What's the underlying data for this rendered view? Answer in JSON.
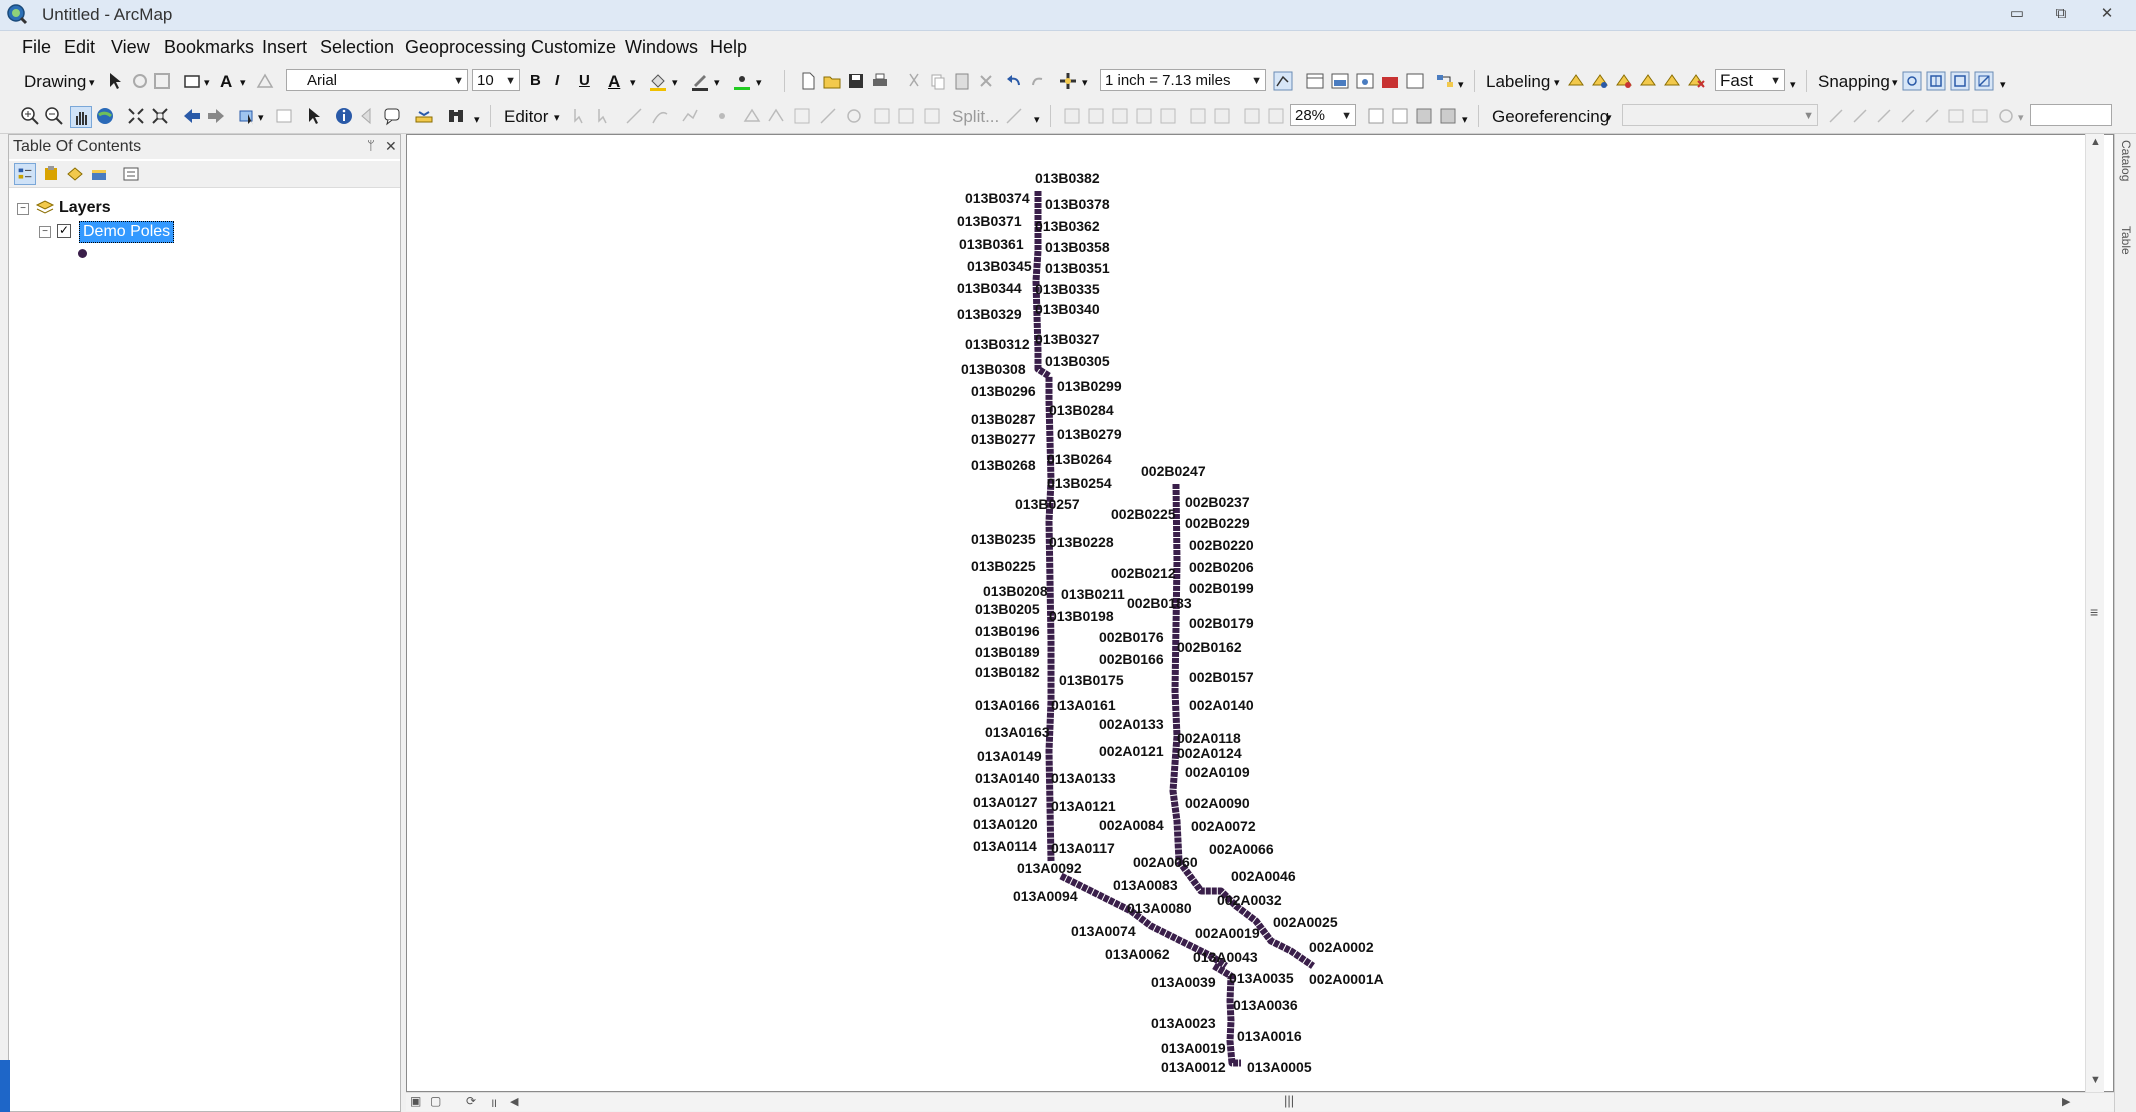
{
  "window": {
    "title": "Untitled - ArcMap",
    "minimize": "▭",
    "maximize": "⧉",
    "close": "✕"
  },
  "menu": [
    "File",
    "Edit",
    "View",
    "Bookmarks",
    "Insert",
    "Selection",
    "Geoprocessing",
    "Customize",
    "Windows",
    "Help"
  ],
  "toolbar1": {
    "drawing": "Drawing",
    "font": "Arial",
    "font_size": "10",
    "bold": "B",
    "italic": "I",
    "underline": "U",
    "font_color": "A",
    "scale": "1 inch = 7.13 miles",
    "labeling": "Labeling",
    "quality": "Fast",
    "snapping": "Snapping"
  },
  "toolbar2": {
    "editor": "Editor",
    "split": "Split...",
    "zoom": "28%",
    "georeferencing": "Georeferencing",
    "georef_layer": ""
  },
  "toc": {
    "title": "Table Of Contents",
    "pin": "ᛘ",
    "close": "✕",
    "root": "Layers",
    "layer": "Demo Poles"
  },
  "colors": {
    "line": "#3a1f4a",
    "selection": "#3399ff"
  },
  "map_labels": [
    "013B0382",
    "013B0374",
    "013B0378",
    "013B0371",
    "013B0362",
    "013B0361",
    "013B0358",
    "013B0345",
    "013B0351",
    "013B0344",
    "013B0335",
    "013B0340",
    "013B0329",
    "013B0312",
    "013B0327",
    "013B0308",
    "013B0305",
    "013B0299",
    "013B0296",
    "013B0284",
    "013B0287",
    "013B0279",
    "013B0277",
    "013B0264",
    "013B0268",
    "013B0254",
    "002B0247",
    "013B0257",
    "002B0237",
    "002B0225",
    "002B0229",
    "013B0235",
    "013B0228",
    "002B0220",
    "013B0225",
    "002B0212",
    "002B0206",
    "002B0199",
    "013B0208",
    "013B0211",
    "002B0183",
    "013B0205",
    "013B0198",
    "002B0179",
    "013B0196",
    "002B0176",
    "002B0162",
    "013B0189",
    "002B0166",
    "013B0182",
    "013B0175",
    "002B0157",
    "013A0166",
    "013A0161",
    "002A0140",
    "002A0133",
    "013A0163",
    "002A0118",
    "013A0149",
    "002A0121",
    "002A0124",
    "002A0109",
    "013A0140",
    "013A0133",
    "013A0127",
    "002A0090",
    "013A0121",
    "013A0120",
    "002A0084",
    "002A0072",
    "013A0114",
    "013A0117",
    "002A0066",
    "002A0060",
    "013A0092",
    "002A0046",
    "013A0083",
    "013A0094",
    "002A0032",
    "013A0080",
    "002A0025",
    "013A0074",
    "002A0019",
    "002A0002",
    "013A0062",
    "013A0043",
    "013A0039",
    "013A0035",
    "002A0001A",
    "013A0036",
    "013A0023",
    "013A0016",
    "013A0019",
    "013A0012",
    "013A0005"
  ]
}
